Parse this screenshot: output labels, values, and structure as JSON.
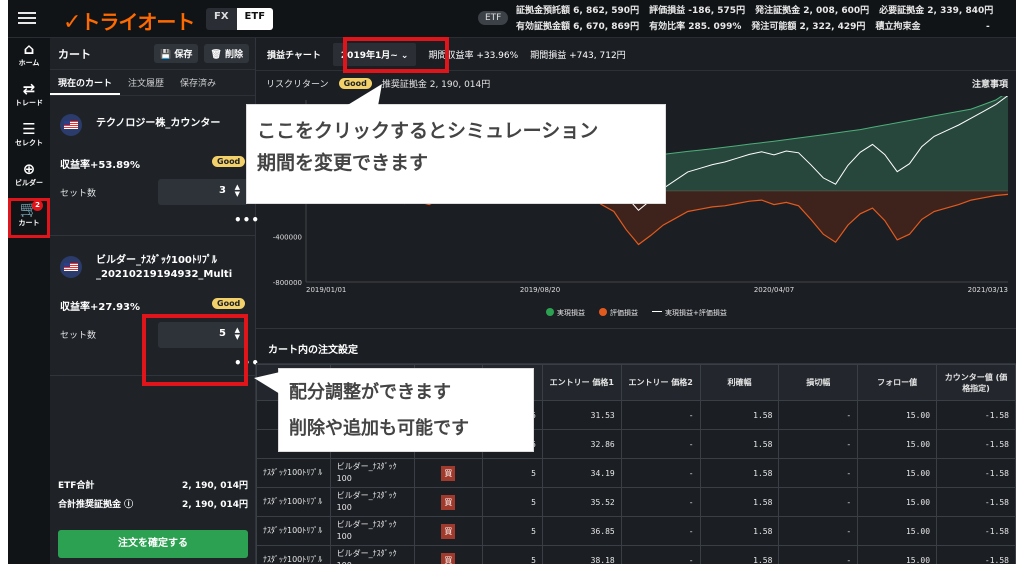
{
  "logo": "トライオート",
  "mode_tabs": {
    "fx": "FX",
    "etf": "ETF"
  },
  "header": {
    "etf_badge": "ETF",
    "stats_row1": [
      "証拠金預託額 6, 862, 590円",
      "評価損益 -186, 575円",
      "発注証拠金 2, 008, 600円",
      "必要証拠金 2, 339, 840円"
    ],
    "stats_row2": [
      "有効証拠金額 6, 670, 869円",
      "有効比率 285. 099%",
      "発注可能額 2, 322, 429円",
      "積立拘束金"
    ],
    "dash": "-"
  },
  "nav": [
    {
      "label": "ホーム",
      "icon": "⌂"
    },
    {
      "label": "トレード",
      "icon": "⇄"
    },
    {
      "label": "セレクト",
      "icon": "☰"
    },
    {
      "label": "ビルダー",
      "icon": "⊕"
    },
    {
      "label": "カート",
      "icon": "🛒",
      "badge": "2"
    }
  ],
  "cart": {
    "title": "カート",
    "save": "保存",
    "delete": "削除",
    "tabs": [
      "現在のカート",
      "注文履歴",
      "保存済み"
    ],
    "items": [
      {
        "name": "テクノロジー株_カウンター",
        "rate": "収益率+53.89%",
        "badge": "Good",
        "set_label": "セット数",
        "sets": "3"
      },
      {
        "name": "ビルダー_ﾅｽﾀﾞｯｸ100ﾄﾘﾌﾟﾙ_20210219194932_Multi",
        "rate": "収益率+27.93%",
        "badge": "Good",
        "set_label": "セット数",
        "sets": "5"
      }
    ],
    "etf_total_label": "ETF合計",
    "etf_total": "2, 190, 014円",
    "margin_label": "合計推奨証拠金",
    "margin": "2, 190, 014円",
    "confirm": "注文を確定する"
  },
  "chart_header": {
    "title": "損益チャート",
    "period": "2019年1月~",
    "period_return": "期間収益率 +33.96%",
    "period_pl": "期間損益 +743, 712円"
  },
  "risk_row": {
    "label": "リスクリターン",
    "badge": "Good",
    "margin": "推奨証拠金 2, 190, 014円",
    "notice": "注意事項"
  },
  "chart_data": {
    "type": "area",
    "x_ticks": [
      "2019/01/01",
      "2019/08/20",
      "2020/04/07",
      "2021/03/13"
    ],
    "y_ticks": [
      "-400000",
      "-800000"
    ],
    "ylim": [
      -800000,
      800000
    ],
    "legend": [
      "実現損益",
      "評価損益",
      "実現損益+評価損益"
    ],
    "colors": {
      "realized": "#3a7a5c",
      "unrealized": "#e35a1e",
      "total": "#ffffff"
    },
    "series": [
      {
        "name": "実現損益",
        "values": [
          0,
          5000,
          12000,
          20000,
          30000,
          42000,
          55000,
          68000,
          80000,
          92000,
          105000,
          118000,
          130000,
          140000,
          150000,
          160000,
          172000,
          185000,
          198000,
          212000,
          228000,
          240000,
          252000,
          262000,
          272000,
          282000,
          292000,
          300000,
          310000,
          322000,
          335000,
          348000,
          360000,
          372000,
          385000,
          398000,
          412000,
          425000,
          438000,
          452000,
          466000,
          480000,
          495000,
          510000,
          525000,
          540000,
          560000,
          580000,
          600000,
          620000,
          640000,
          660000,
          680000,
          700000,
          720000,
          760000,
          800000,
          870000
        ]
      },
      {
        "name": "評価損益",
        "values": [
          0,
          -20000,
          -30000,
          -15000,
          -40000,
          -60000,
          -35000,
          -80000,
          -110000,
          -90000,
          -120000,
          -60000,
          -40000,
          -90000,
          -70000,
          -30000,
          -50000,
          -100000,
          -80000,
          -40000,
          -60000,
          -90000,
          -70000,
          -50000,
          -120000,
          -180000,
          -340000,
          -470000,
          -390000,
          -300000,
          -240000,
          -180000,
          -160000,
          -140000,
          -130000,
          -110000,
          -90000,
          -80000,
          -120000,
          -100000,
          -130000,
          -250000,
          -380000,
          -450000,
          -300000,
          -200000,
          -150000,
          -260000,
          -430000,
          -380000,
          -250000,
          -180000,
          -150000,
          -120000,
          -80000,
          -60000,
          -40000,
          -30000
        ]
      },
      {
        "name": "実現損益+評価損益",
        "values": [
          0,
          -15000,
          -18000,
          5000,
          -10000,
          -18000,
          20000,
          -12000,
          -30000,
          2000,
          -15000,
          58000,
          90000,
          50000,
          80000,
          130000,
          122000,
          85000,
          118000,
          172000,
          168000,
          150000,
          182000,
          212000,
          152000,
          102000,
          -48000,
          -170000,
          -80000,
          22000,
          95000,
          168000,
          200000,
          232000,
          255000,
          288000,
          322000,
          345000,
          318000,
          352000,
          336000,
          230000,
          115000,
          60000,
          225000,
          340000,
          410000,
          320000,
          170000,
          240000,
          390000,
          480000,
          530000,
          580000,
          640000,
          700000,
          760000,
          840000
        ]
      }
    ]
  },
  "orders": {
    "title": "カート内の注文設定",
    "headers": [
      "",
      "",
      "",
      "万/口)",
      "エントリー 価格1",
      "エントリー 価格2",
      "利確幅",
      "損切幅",
      "フォロー値",
      "カウンター値 (価格指定)"
    ],
    "rows": [
      {
        "a": "",
        "b": "",
        "buy": "",
        "qty": "5",
        "e1": "31.53",
        "e2": "-",
        "tp": "1.58",
        "sl": "-",
        "fw": "15.00",
        "ct": "-1.58"
      },
      {
        "a": "",
        "b": "",
        "buy": "",
        "qty": "5",
        "e1": "32.86",
        "e2": "-",
        "tp": "1.58",
        "sl": "-",
        "fw": "15.00",
        "ct": "-1.58"
      },
      {
        "a": "ﾅｽﾀﾞｯｸ100ﾄﾘﾌﾟﾙ",
        "b": "ビルダー_ﾅｽﾀﾞｯｸ100",
        "buy": "買",
        "qty": "5",
        "e1": "34.19",
        "e2": "-",
        "tp": "1.58",
        "sl": "-",
        "fw": "15.00",
        "ct": "-1.58"
      },
      {
        "a": "ﾅｽﾀﾞｯｸ100ﾄﾘﾌﾟﾙ",
        "b": "ビルダー_ﾅｽﾀﾞｯｸ100",
        "buy": "買",
        "qty": "5",
        "e1": "35.52",
        "e2": "-",
        "tp": "1.58",
        "sl": "-",
        "fw": "15.00",
        "ct": "-1.58"
      },
      {
        "a": "ﾅｽﾀﾞｯｸ100ﾄﾘﾌﾟﾙ",
        "b": "ビルダー_ﾅｽﾀﾞｯｸ100",
        "buy": "買",
        "qty": "5",
        "e1": "36.85",
        "e2": "-",
        "tp": "1.58",
        "sl": "-",
        "fw": "15.00",
        "ct": "-1.58"
      },
      {
        "a": "ﾅｽﾀﾞｯｸ100ﾄﾘﾌﾟﾙ",
        "b": "ビルダー_ﾅｽﾀﾞｯｸ100",
        "buy": "買",
        "qty": "5",
        "e1": "38.18",
        "e2": "-",
        "tp": "1.58",
        "sl": "-",
        "fw": "15.00",
        "ct": "-1.58"
      }
    ]
  },
  "callouts": {
    "top": [
      "ここをクリックするとシミュレーション",
      "期間を変更できます"
    ],
    "bottom": [
      "配分調整ができます",
      "削除や追加も可能です"
    ]
  }
}
